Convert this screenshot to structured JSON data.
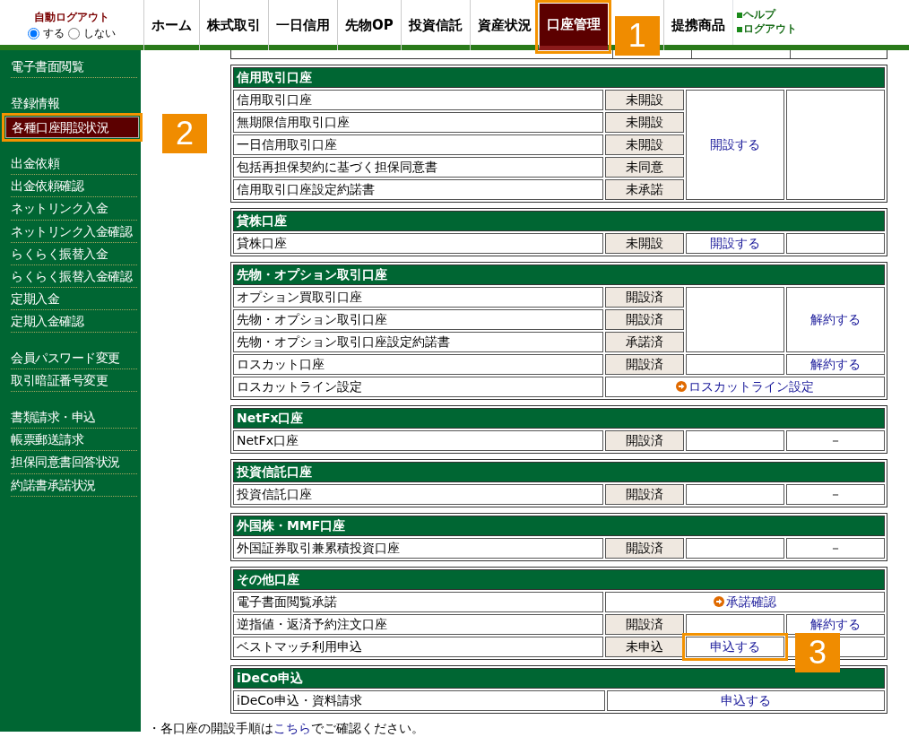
{
  "auto_logout": {
    "title": "自動ログアウト",
    "options": [
      {
        "label": "する",
        "selected": true
      },
      {
        "label": "しない",
        "selected": false
      }
    ]
  },
  "nav": [
    {
      "label": "ホーム",
      "selected": false
    },
    {
      "label": "株式取引",
      "selected": false
    },
    {
      "label": "一日信用",
      "selected": false
    },
    {
      "label": "先物OP",
      "selected": false
    },
    {
      "label": "投資信託",
      "selected": false
    },
    {
      "label": "資産状況",
      "selected": false
    },
    {
      "label": "口座管理",
      "selected": true,
      "highlighted": true
    },
    {
      "label": "提携商品",
      "selected": false
    }
  ],
  "nav_help": [
    "ヘルプ",
    "ログアウト"
  ],
  "sidebar": [
    [
      {
        "label": "電子書面閲覧",
        "selected": false
      }
    ],
    [
      {
        "label": "登録情報",
        "selected": false
      },
      {
        "label": "各種口座開設状況",
        "selected": true,
        "highlighted": true
      }
    ],
    [
      {
        "label": "出金依頼",
        "selected": false
      },
      {
        "label": "出金依頼確認",
        "selected": false
      },
      {
        "label": "ネットリンク入金",
        "selected": false
      },
      {
        "label": "ネットリンク入金確認",
        "selected": false
      },
      {
        "label": "らくらく振替入金",
        "selected": false
      },
      {
        "label": "らくらく振替入金確認",
        "selected": false
      },
      {
        "label": "定期入金",
        "selected": false
      },
      {
        "label": "定期入金確認",
        "selected": false
      }
    ],
    [
      {
        "label": "会員パスワード変更",
        "selected": false
      },
      {
        "label": "取引暗証番号変更",
        "selected": false
      }
    ],
    [
      {
        "label": "書類請求・申込",
        "selected": false
      },
      {
        "label": "帳票郵送請求",
        "selected": false
      },
      {
        "label": "担保同意書回答状況",
        "selected": false
      },
      {
        "label": "約諾書承諾状況",
        "selected": false
      }
    ]
  ],
  "sections": [
    {
      "title": "信用取引口座",
      "rows": [
        {
          "label": "信用取引口座",
          "status": "未開設",
          "actions": [
            {
              "kind": "link",
              "text": "開設する"
            },
            {
              "kind": "blank"
            }
          ]
        },
        {
          "label": "無期限信用取引口座",
          "status": "未開設"
        },
        {
          "label": "一日信用取引口座",
          "status": "未開設"
        },
        {
          "label": "包括再担保契約に基づく担保同意書",
          "status": "未同意"
        },
        {
          "label": "信用取引口座設定約諾書",
          "status": "未承諾"
        }
      ]
    },
    {
      "title": "貸株口座",
      "rows": [
        {
          "label": "貸株口座",
          "status": "未開設",
          "actions": [
            {
              "kind": "link",
              "text": "開設する"
            },
            {
              "kind": "blank"
            }
          ]
        }
      ]
    },
    {
      "title": "先物・オプション取引口座",
      "rows": [
        {
          "label": "オプション買取引口座",
          "status": "開設済",
          "actions": [
            {
              "kind": "blank"
            },
            {
              "kind": "link",
              "text": "解約する"
            }
          ]
        },
        {
          "label": "先物・オプション取引口座",
          "status": "開設済"
        },
        {
          "label": "先物・オプション取引口座設定約諾書",
          "status": "承諾済"
        },
        {
          "label": "ロスカット口座",
          "status": "開設済",
          "actions": [
            {
              "kind": "blank"
            },
            {
              "kind": "link",
              "text": "解約する"
            }
          ]
        },
        {
          "label": "ロスカットライン設定",
          "actions": [
            {
              "kind": "arrow-link",
              "text": "ロスカットライン設定"
            }
          ]
        }
      ]
    },
    {
      "title": "NetFx口座",
      "rows": [
        {
          "label": "NetFx口座",
          "status": "開設済",
          "actions": [
            {
              "kind": "blank"
            },
            {
              "kind": "text",
              "text": "－"
            }
          ]
        }
      ]
    },
    {
      "title": "投資信託口座",
      "rows": [
        {
          "label": "投資信託口座",
          "status": "開設済",
          "actions": [
            {
              "kind": "blank"
            },
            {
              "kind": "text",
              "text": "－"
            }
          ]
        }
      ]
    },
    {
      "title": "外国株・MMF口座",
      "rows": [
        {
          "label": "外国証券取引兼累積投資口座",
          "status": "開設済",
          "actions": [
            {
              "kind": "blank"
            },
            {
              "kind": "text",
              "text": "－"
            }
          ]
        }
      ]
    },
    {
      "title": "その他口座",
      "rows": [
        {
          "label": "電子書面閲覧承諾",
          "actions": [
            {
              "kind": "arrow-link",
              "text": "承諾確認"
            }
          ]
        },
        {
          "label": "逆指値・返済予約注文口座",
          "status": "開設済",
          "actions": [
            {
              "kind": "blank"
            },
            {
              "kind": "link",
              "text": "解約する"
            }
          ]
        },
        {
          "label": "ベストマッチ利用申込",
          "status": "未申込",
          "actions": [
            {
              "kind": "link",
              "text": "申込する",
              "highlighted": true
            },
            {
              "kind": "blank"
            }
          ]
        }
      ]
    },
    {
      "title": "iDeCo申込",
      "rows": [
        {
          "label": "iDeCo申込・資料請求",
          "actions": [
            {
              "kind": "link",
              "text": "申込する"
            }
          ]
        }
      ]
    }
  ],
  "note": {
    "before": "・各口座の開設手順は",
    "link": "こちら",
    "after": "でご確認ください。"
  },
  "callouts": [
    "1",
    "2",
    "3"
  ]
}
